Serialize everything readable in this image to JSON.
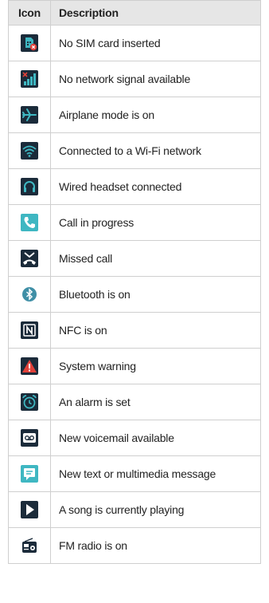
{
  "table": {
    "header_icon": "Icon",
    "header_description": "Description"
  },
  "rows": [
    {
      "icon": "no-sim-icon",
      "description": "No SIM card inserted"
    },
    {
      "icon": "no-signal-icon",
      "description": "No network signal available"
    },
    {
      "icon": "airplane-icon",
      "description": "Airplane mode is on"
    },
    {
      "icon": "wifi-icon",
      "description": "Connected to a Wi-Fi network"
    },
    {
      "icon": "headset-icon",
      "description": "Wired headset connected"
    },
    {
      "icon": "phone-icon",
      "description": "Call in progress"
    },
    {
      "icon": "missed-call-icon",
      "description": "Missed call"
    },
    {
      "icon": "bluetooth-icon",
      "description": "Bluetooth is on"
    },
    {
      "icon": "nfc-icon",
      "description": "NFC is on"
    },
    {
      "icon": "warning-icon",
      "description": "System warning"
    },
    {
      "icon": "alarm-icon",
      "description": "An alarm is set"
    },
    {
      "icon": "voicemail-icon",
      "description": "New voicemail available"
    },
    {
      "icon": "message-icon",
      "description": "New text or multimedia message"
    },
    {
      "icon": "play-icon",
      "description": "A song is currently playing"
    },
    {
      "icon": "radio-icon",
      "description": "FM radio is on"
    }
  ],
  "colors": {
    "icon_tile": "#1b2b3a",
    "accent_teal": "#3fb7c2",
    "alert_red": "#e0413a",
    "header_bg": "#e6e6e6",
    "border": "#cfcfcf"
  }
}
